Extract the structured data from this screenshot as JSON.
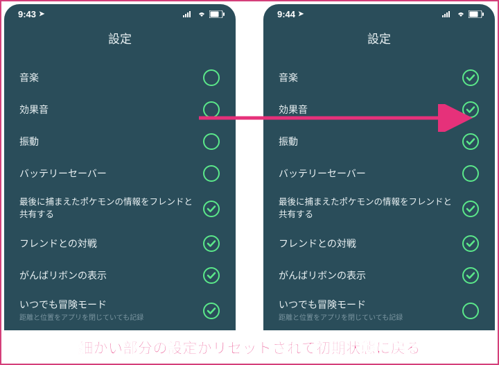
{
  "caption": "細かい部分の設定がリセットされて初期状態に戻る",
  "phones": [
    {
      "time": "9:43",
      "title": "設定",
      "settings": [
        {
          "label": "音楽",
          "checked": false
        },
        {
          "label": "効果音",
          "checked": false
        },
        {
          "label": "振動",
          "checked": false
        },
        {
          "label": "バッテリーセーバー",
          "checked": false
        },
        {
          "label": "最後に捕まえたポケモンの情報をフレンドと共有する",
          "checked": true,
          "small": true
        },
        {
          "label": "フレンドとの対戦",
          "checked": true
        },
        {
          "label": "がんばリボンの表示",
          "checked": true
        },
        {
          "label": "いつでも冒険モード",
          "subtitle": "距離と位置をアプリを閉じていても記録",
          "checked": true
        }
      ]
    },
    {
      "time": "9:44",
      "title": "設定",
      "settings": [
        {
          "label": "音楽",
          "checked": true
        },
        {
          "label": "効果音",
          "checked": true
        },
        {
          "label": "振動",
          "checked": true
        },
        {
          "label": "バッテリーセーバー",
          "checked": false
        },
        {
          "label": "最後に捕まえたポケモンの情報をフレンドと共有する",
          "checked": true,
          "small": true
        },
        {
          "label": "フレンドとの対戦",
          "checked": true
        },
        {
          "label": "がんばリボンの表示",
          "checked": true
        },
        {
          "label": "いつでも冒険モード",
          "subtitle": "距離と位置をアプリを閉じていても記録",
          "checked": false
        }
      ]
    }
  ],
  "colors": {
    "accent": "#5be88a",
    "phone_bg": "#2a4d5a",
    "caption": "#e6317a",
    "border": "#d43f7a"
  }
}
